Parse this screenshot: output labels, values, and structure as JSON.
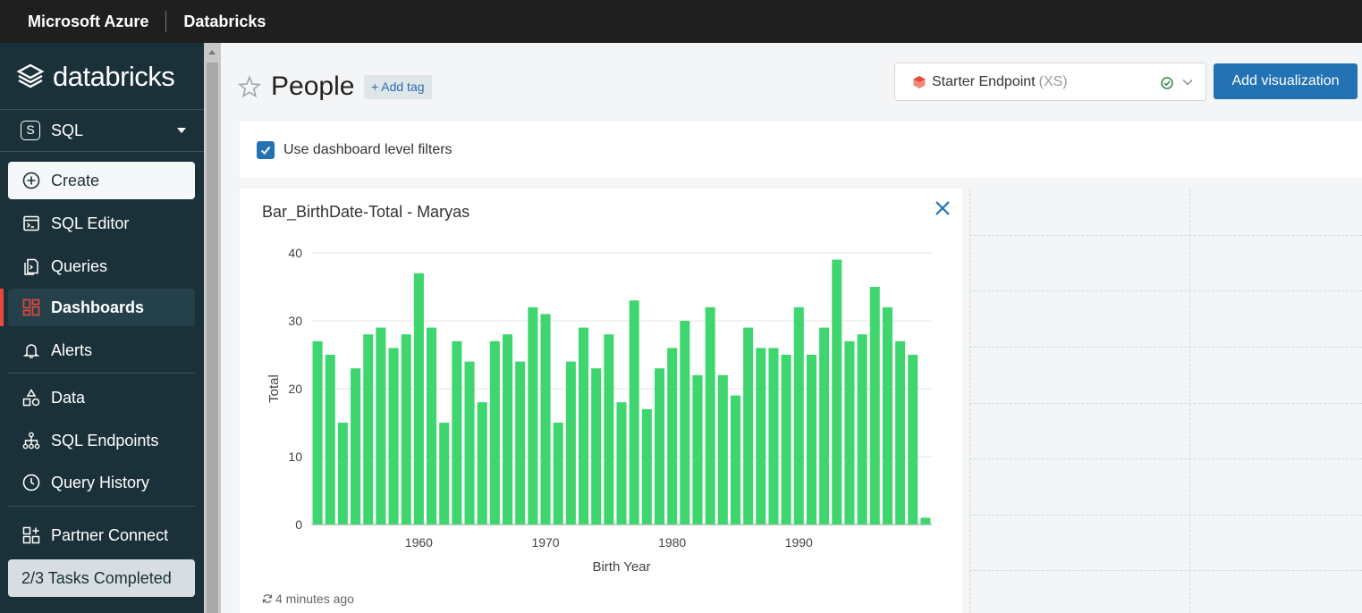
{
  "topbar": {
    "brand": "Microsoft Azure",
    "product": "Databricks"
  },
  "sidebar": {
    "logo_text": "databricks",
    "persona": {
      "badge": "S",
      "label": "SQL"
    },
    "items": [
      {
        "label": "Create",
        "icon": "plus-circle-icon"
      },
      {
        "label": "SQL Editor",
        "icon": "sql-editor-icon"
      },
      {
        "label": "Queries",
        "icon": "queries-icon"
      },
      {
        "label": "Dashboards",
        "icon": "dashboards-icon",
        "active": true
      },
      {
        "label": "Alerts",
        "icon": "bell-icon"
      },
      {
        "label": "Data",
        "icon": "data-icon"
      },
      {
        "label": "SQL Endpoints",
        "icon": "endpoints-icon"
      },
      {
        "label": "Query History",
        "icon": "clock-icon"
      },
      {
        "label": "Partner Connect",
        "icon": "partner-connect-icon"
      }
    ],
    "tasks": "2/3 Tasks Completed"
  },
  "header": {
    "title": "People",
    "add_tag": "+ Add tag",
    "endpoint": {
      "name": "Starter Endpoint",
      "size": "(XS)"
    },
    "add_visualization": "Add visualization"
  },
  "filters": {
    "label": "Use dashboard level filters",
    "checked": true
  },
  "widget": {
    "title": "Bar_BirthDate-Total - Maryas",
    "footer": "4 minutes ago"
  },
  "colors": {
    "bar": "#3fd56f",
    "accent": "#2272b4",
    "sidebar": "#1b3139",
    "active_marker": "#e9483b"
  },
  "chart_data": {
    "type": "bar",
    "xlabel": "Birth Year",
    "ylabel": "Total",
    "ylim": [
      0,
      40
    ],
    "yticks": [
      0,
      10,
      20,
      30,
      40
    ],
    "xticks": [
      1960,
      1970,
      1980,
      1990
    ],
    "xlim": [
      1951.5,
      2000.5
    ],
    "x": [
      1952,
      1953,
      1954,
      1955,
      1956,
      1957,
      1958,
      1959,
      1960,
      1961,
      1962,
      1963,
      1964,
      1965,
      1966,
      1967,
      1968,
      1969,
      1970,
      1971,
      1972,
      1973,
      1974,
      1975,
      1976,
      1977,
      1978,
      1979,
      1980,
      1981,
      1982,
      1983,
      1984,
      1985,
      1986,
      1987,
      1988,
      1989,
      1990,
      1991,
      1992,
      1993,
      1994,
      1995,
      1996,
      1997,
      1998,
      1999,
      2000
    ],
    "values": [
      27,
      25,
      15,
      23,
      28,
      29,
      26,
      28,
      37,
      29,
      15,
      27,
      24,
      18,
      27,
      28,
      24,
      32,
      31,
      15,
      24,
      29,
      23,
      28,
      18,
      33,
      17,
      23,
      26,
      30,
      22,
      32,
      22,
      19,
      29,
      26,
      26,
      25,
      32,
      25,
      29,
      39,
      27,
      28,
      35,
      32,
      27,
      25,
      1
    ]
  }
}
